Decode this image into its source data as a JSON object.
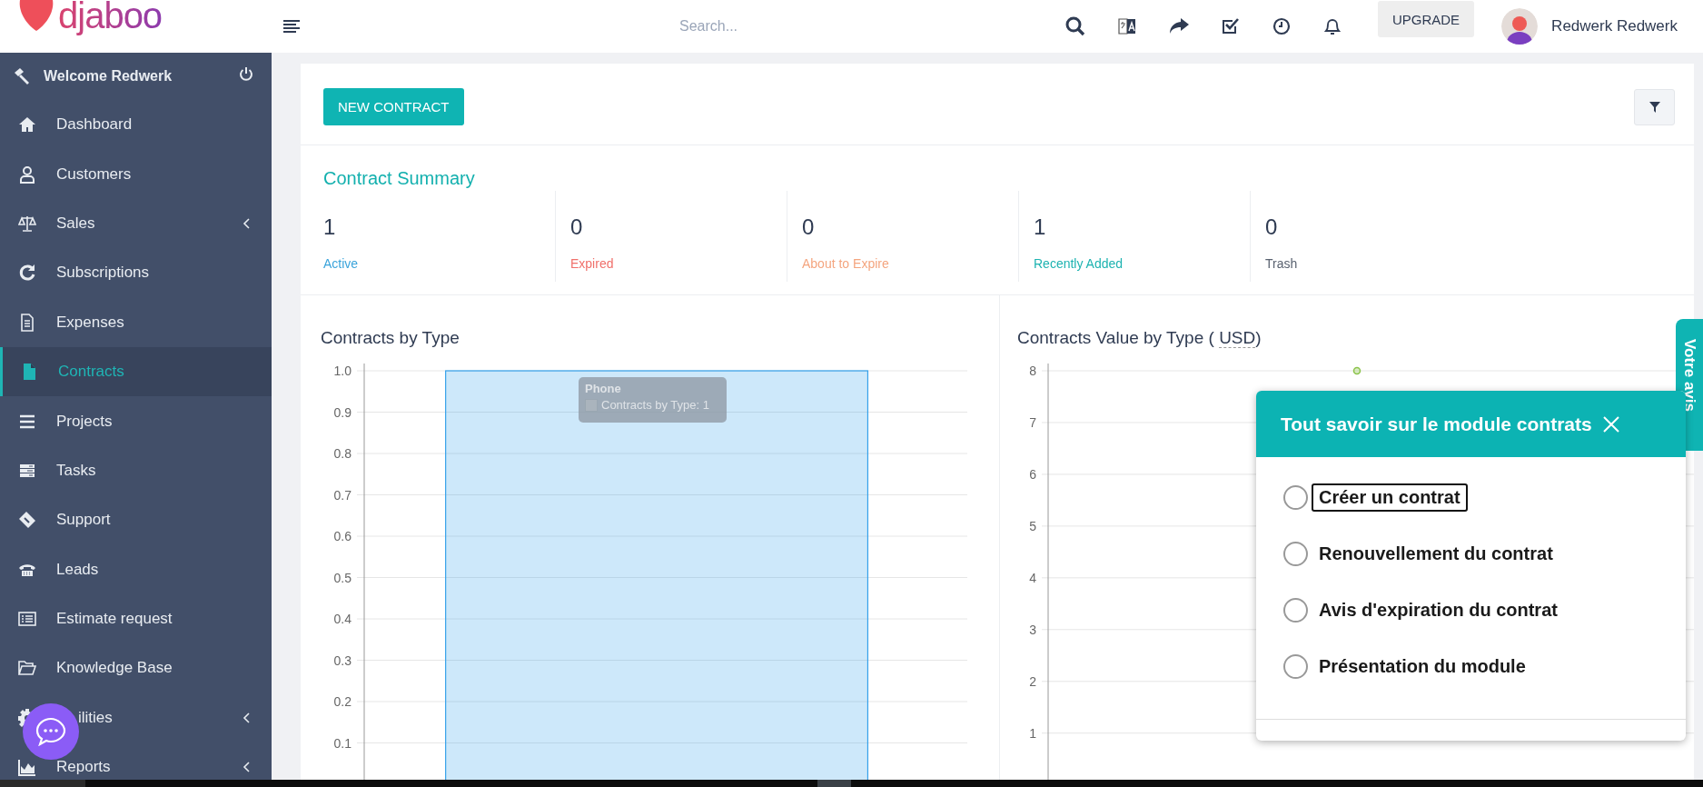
{
  "header": {
    "logo": "djaboo",
    "search": {
      "placeholder": "Search..."
    },
    "upgrade_button": "UPGRADE",
    "user_name": "Redwerk Redwerk"
  },
  "sidebar": {
    "welcome": "Welcome Redwerk",
    "items": [
      {
        "label": "Dashboard",
        "selected": false,
        "has_submenu": false
      },
      {
        "label": "Customers",
        "selected": false,
        "has_submenu": false
      },
      {
        "label": "Sales",
        "selected": false,
        "has_submenu": true
      },
      {
        "label": "Subscriptions",
        "selected": false,
        "has_submenu": false
      },
      {
        "label": "Expenses",
        "selected": false,
        "has_submenu": false
      },
      {
        "label": "Contracts",
        "selected": true,
        "has_submenu": false
      },
      {
        "label": "Projects",
        "selected": false,
        "has_submenu": false
      },
      {
        "label": "Tasks",
        "selected": false,
        "has_submenu": false
      },
      {
        "label": "Support",
        "selected": false,
        "has_submenu": false
      },
      {
        "label": "Leads",
        "selected": false,
        "has_submenu": false
      },
      {
        "label": "Estimate request",
        "selected": false,
        "has_submenu": false
      },
      {
        "label": "Knowledge Base",
        "selected": false,
        "has_submenu": false
      },
      {
        "label": "ilities",
        "selected": false,
        "has_submenu": true
      },
      {
        "label": "Reports",
        "selected": false,
        "has_submenu": true
      }
    ]
  },
  "toolbar": {
    "new_button": "NEW CONTRACT"
  },
  "summary": {
    "title": "Contract Summary",
    "stats": [
      {
        "value": "1",
        "label": "Active",
        "color": "#3ba4db"
      },
      {
        "value": "0",
        "label": "Expired",
        "color": "#f0706b"
      },
      {
        "value": "0",
        "label": "About to Expire",
        "color": "#f4a57f"
      },
      {
        "value": "1",
        "label": "Recently Added",
        "color": "#1eb3b1"
      },
      {
        "value": "0",
        "label": "Trash",
        "color": "#5a6270"
      }
    ]
  },
  "type_chart": {
    "title": "Contracts by Type",
    "tooltip": {
      "title": "Phone",
      "text": "Contracts by Type: 1"
    },
    "chart_data": {
      "type": "bar",
      "grid": true,
      "ylim": [
        0,
        1
      ],
      "yticks": [
        0.1,
        0.2,
        0.3,
        0.4,
        0.5,
        0.6,
        0.7,
        0.8,
        0.9,
        {
          "value": 1,
          "label": "1.0"
        }
      ],
      "series": [
        {
          "color": "#36a2eb",
          "values": [
            1
          ]
        }
      ]
    }
  },
  "value_chart": {
    "title": "Contracts Value by Type (",
    "currency": "USD",
    "title_end": ")",
    "chart_data": {
      "type": "line",
      "grid": true,
      "ylim": [
        0.1,
        8
      ],
      "yticks": [
        1,
        2,
        3,
        4,
        5,
        6,
        7,
        8
      ],
      "series": [
        {
          "color": "#8bc34a",
          "marker": true,
          "values": [
            8
          ]
        }
      ]
    }
  },
  "popup": {
    "title": "Tout savoir sur le module contrats",
    "items": [
      {
        "label": "Créer un contrat",
        "checked": false,
        "focused": true
      },
      {
        "label": "Renouvellement du contrat",
        "checked": false,
        "focused": false
      },
      {
        "label": "Avis d'expiration du contrat",
        "checked": false,
        "focused": false
      },
      {
        "label": "Présentation du module",
        "checked": false,
        "focused": false
      }
    ]
  },
  "feedback_tab": "Votre avis"
}
